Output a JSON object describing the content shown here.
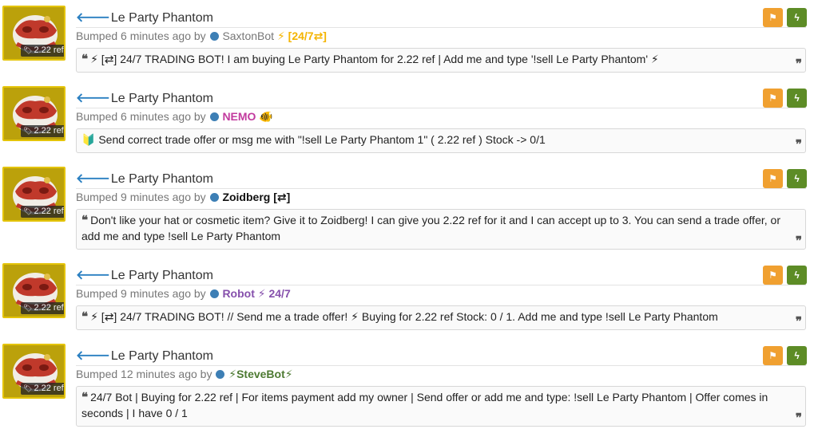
{
  "listings": [
    {
      "item_name": "Le Party Phantom",
      "price": "2.22 ref",
      "bumped": "Bumped 6 minutes ago by",
      "username": "SaxtonBot",
      "user_suffix": "⚡ [24/7⇄]",
      "user_color": "#777777",
      "message": "⚡ [⇄] 24/7 TRADING BOT! I am buying Le Party Phantom for 2.22 ref | Add me and type '!sell Le Party Phantom' ⚡"
    },
    {
      "item_name": "Le Party Phantom",
      "price": "2.22 ref",
      "bumped": "Bumped 6 minutes ago by",
      "username": "NEMO",
      "user_suffix": "🐠",
      "user_color": "#c23a9e",
      "message": "🔰 Send correct trade offer or msg me with \"!sell Le Party Phantom 1\" ( 2.22 ref ) Stock -> 0/1"
    },
    {
      "item_name": "Le Party Phantom",
      "price": "2.22 ref",
      "bumped": "Bumped 9 minutes ago by",
      "username": "Zoidberg [⇄]",
      "user_suffix": "",
      "user_color": "#111111",
      "message": "Don't like your hat or cosmetic item? Give it to Zoidberg! I can give you 2.22 ref for it and I can accept up to 3. You can send a trade offer, or add me and type !sell Le Party Phantom"
    },
    {
      "item_name": "Le Party Phantom",
      "price": "2.22 ref",
      "bumped": "Bumped 9 minutes ago by",
      "username": "Robot",
      "user_suffix": "⚡ 24/7",
      "user_color": "#8650ac",
      "message": "⚡ [⇄] 24/7 TRADING BOT! // Send me a trade offer! ⚡ Buying for 2.22 ref Stock: 0 / 1. Add me and type !sell Le Party Phantom"
    },
    {
      "item_name": "Le Party Phantom",
      "price": "2.22 ref",
      "bumped": "Bumped 12 minutes ago by",
      "username": "⚡SteveBot⚡",
      "user_suffix": "",
      "user_color": "#4d7a32",
      "message": "24/7 Bot | Buying for 2.22 ref | For items payment add my owner | Send offer or add me and type: !sell Le Party Phantom | Offer comes in seconds | I have 0 / 1"
    }
  ],
  "icons": {
    "back": "arrow-left-icon",
    "flag": "flag-icon",
    "bolt": "lightning-icon",
    "quote_open": "quote-open-icon",
    "quote_close": "quote-close-icon",
    "tag": "tag-icon"
  },
  "colors": {
    "thumb_bg": "#bba10b",
    "thumb_border": "#e4c409",
    "flag_button": "#f0a030",
    "bolt_button": "#5d8c26",
    "link_blue": "#2a7fc1"
  }
}
